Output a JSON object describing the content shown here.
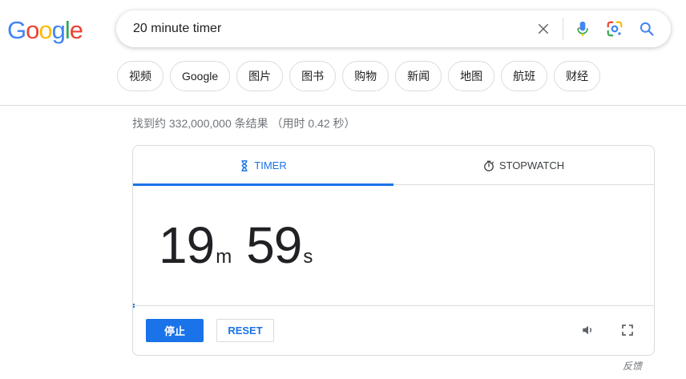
{
  "logo": {
    "text": "Google",
    "letters": [
      "G",
      "o",
      "o",
      "g",
      "l",
      "e"
    ],
    "colors": [
      "#4285f4",
      "#ea4335",
      "#fbbc05",
      "#4285f4",
      "#34a853",
      "#ea4335"
    ]
  },
  "search": {
    "query": "20 minute timer"
  },
  "icons": {
    "clear": "close-icon",
    "voice": "microphone-icon",
    "lens": "google-lens-icon",
    "search": "search-icon"
  },
  "chips": [
    "视频",
    "Google",
    "图片",
    "图书",
    "购物",
    "新闻",
    "地图",
    "航班",
    "财经"
  ],
  "result_stats": "找到约 332,000,000 条结果 （用时 0.42 秒）",
  "timer": {
    "tabs": [
      {
        "label": "TIMER",
        "icon": "hourglass-icon",
        "active": true
      },
      {
        "label": "STOPWATCH",
        "icon": "stopwatch-icon",
        "active": false
      }
    ],
    "minutes": "19",
    "minutes_unit": "m",
    "seconds": "59",
    "seconds_unit": "s",
    "stop_label": "停止",
    "reset_label": "RESET"
  },
  "feedback": "反馈",
  "colors": {
    "accent": "#1a73e8",
    "border": "#dadce0",
    "muted": "#70757a"
  }
}
